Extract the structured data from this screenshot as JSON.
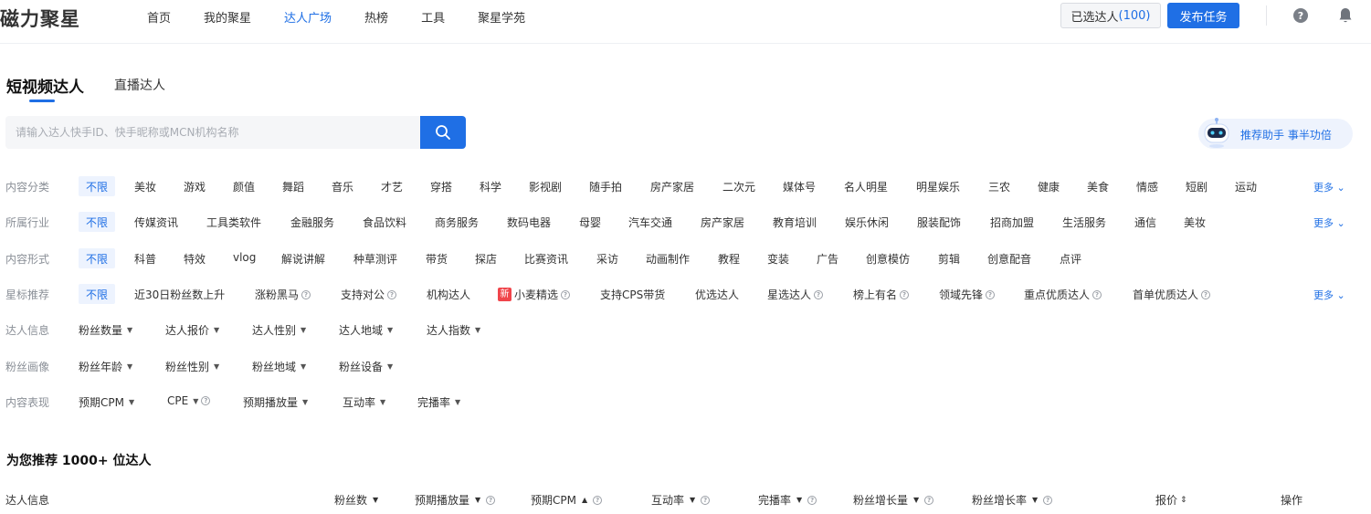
{
  "app": {
    "logo": "磁力聚星"
  },
  "nav": {
    "items": [
      "首页",
      "我的聚星",
      "达人广场",
      "热榜",
      "工具",
      "聚星学苑"
    ],
    "active_index": 2
  },
  "header": {
    "selected_label": "已选达人",
    "selected_count": "(100)",
    "publish_label": "发布任务"
  },
  "tabs": {
    "short_video": "短视频达人",
    "live": "直播达人"
  },
  "search": {
    "placeholder": "请输入达人快手ID、快手昵称或MCN机构名称",
    "value": ""
  },
  "assistant": {
    "label": "推荐助手 事半功倍"
  },
  "filters": {
    "more_label": "更多",
    "rows": [
      {
        "label": "内容分类",
        "options": [
          "不限",
          "美妆",
          "游戏",
          "颜值",
          "舞蹈",
          "音乐",
          "才艺",
          "穿搭",
          "科学",
          "影视剧",
          "随手拍",
          "房产家居",
          "二次元",
          "媒体号",
          "名人明星",
          "明星娱乐",
          "三农",
          "健康",
          "美食",
          "情感",
          "短剧",
          "运动"
        ]
      },
      {
        "label": "所属行业",
        "options": [
          "不限",
          "传媒资讯",
          "工具类软件",
          "金融服务",
          "食品饮料",
          "商务服务",
          "数码电器",
          "母婴",
          "汽车交通",
          "房产家居",
          "教育培训",
          "娱乐休闲",
          "服装配饰",
          "招商加盟",
          "生活服务",
          "通信",
          "美妆"
        ]
      },
      {
        "label": "内容形式",
        "options": [
          "不限",
          "科普",
          "特效",
          "vlog",
          "解说讲解",
          "种草测评",
          "带货",
          "探店",
          "比赛资讯",
          "采访",
          "动画制作",
          "教程",
          "变装",
          "广告",
          "创意模仿",
          "剪辑",
          "创意配音",
          "点评"
        ]
      },
      {
        "label": "星标推荐",
        "options": [
          "不限",
          "近30日粉丝数上升",
          "涨粉黑马",
          "支持对公",
          "机构达人",
          "小麦精选",
          "支持CPS带货",
          "优选达人",
          "星选达人",
          "榜上有名",
          "领域先锋",
          "重点优质达人",
          "首单优质达人"
        ],
        "new_badge": "新"
      },
      {
        "label": "达人信息",
        "options": [
          "粉丝数量",
          "达人报价",
          "达人性别",
          "达人地域",
          "达人指数"
        ]
      },
      {
        "label": "粉丝画像",
        "options": [
          "粉丝年龄",
          "粉丝性别",
          "粉丝地域",
          "粉丝设备"
        ]
      },
      {
        "label": "内容表现",
        "options": [
          "预期CPM",
          "CPE",
          "预期播放量",
          "互动率",
          "完播率"
        ]
      }
    ]
  },
  "recommend": {
    "title": "为您推荐 1000+ 位达人"
  },
  "table": {
    "headers": [
      "达人信息",
      "粉丝数",
      "预期播放量",
      "预期CPM",
      "互动率",
      "完播率",
      "粉丝增长量",
      "粉丝增长率",
      "报价",
      "操作"
    ]
  },
  "colors": {
    "accent": "#1f6fe5",
    "new_badge": "#f0454b"
  }
}
